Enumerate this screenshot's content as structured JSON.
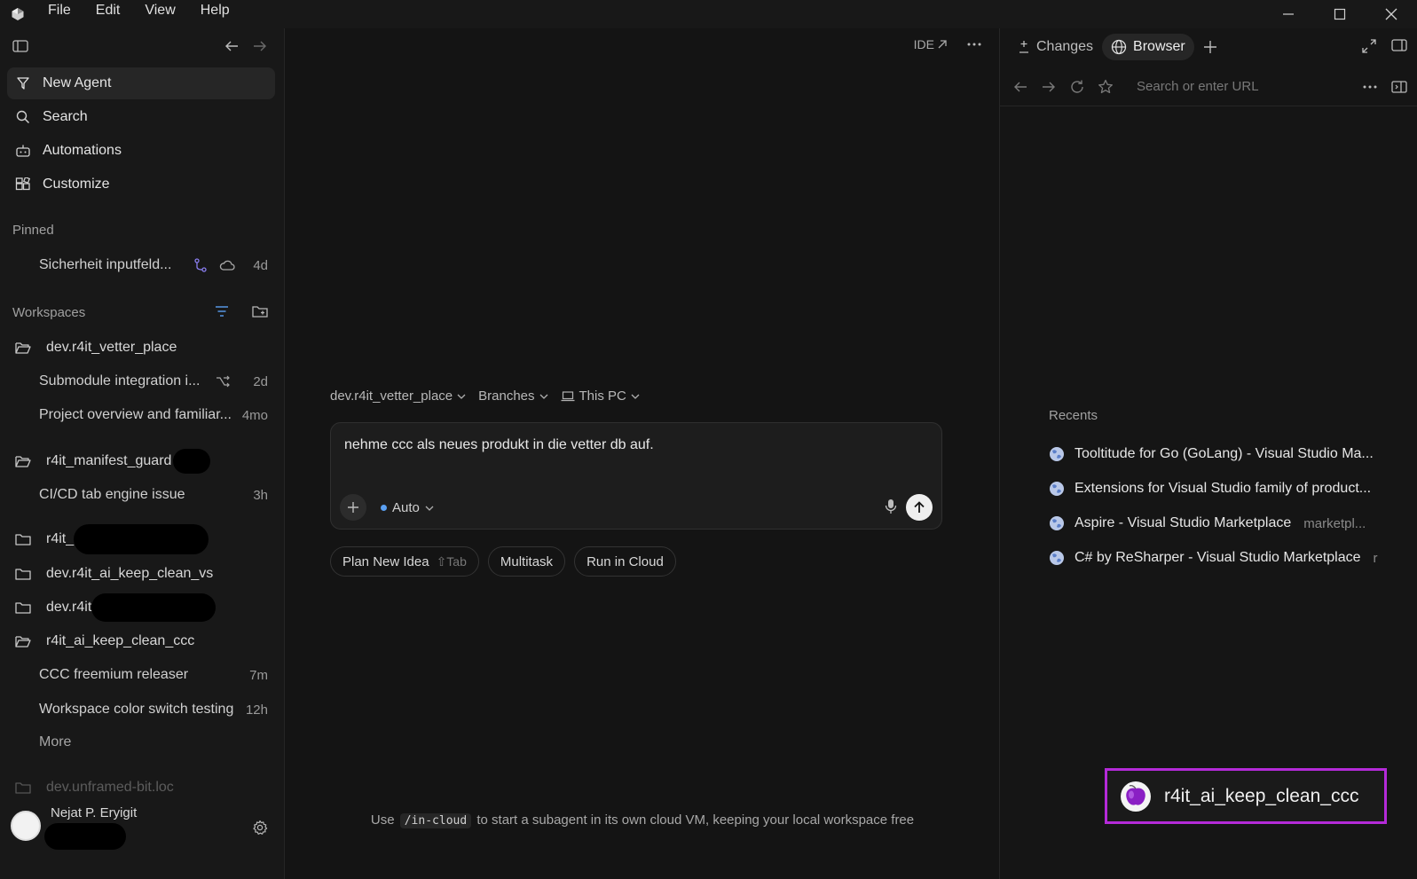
{
  "menu": [
    "File",
    "Edit",
    "View",
    "Help"
  ],
  "sidebar": {
    "nav": [
      {
        "label": "New Agent",
        "icon": "agent-icon"
      },
      {
        "label": "Search",
        "icon": "search-icon"
      },
      {
        "label": "Automations",
        "icon": "robot-icon"
      },
      {
        "label": "Customize",
        "icon": "customize-icon"
      }
    ],
    "pinned_label": "Pinned",
    "pinned": [
      {
        "title": "Sicherheit inputfeld...",
        "age": "4d"
      }
    ],
    "workspaces_label": "Workspaces",
    "workspaces": [
      {
        "name": "dev.r4it_vetter_place"
      },
      {
        "name": "r4it_manifest_guard"
      },
      {
        "name": "r4it_"
      },
      {
        "name": "dev.r4it_ai_keep_clean_vs"
      },
      {
        "name": "dev.r4it"
      },
      {
        "name": "r4it_ai_keep_clean_ccc"
      },
      {
        "name": "dev.unframed-bit.loc"
      }
    ],
    "threads": [
      {
        "title": "Submodule integration i...",
        "age": "2d"
      },
      {
        "title": "Project overview and familiar...",
        "age": "4mo"
      },
      {
        "title": "CI/CD tab engine issue",
        "age": "3h"
      },
      {
        "title": "CCC freemium releaser",
        "age": "7m"
      },
      {
        "title": "Workspace color switch testing",
        "age": "12h"
      }
    ],
    "more_label": "More",
    "user_name": "Nejat P. Eryigit"
  },
  "main": {
    "ide_label": "IDE",
    "context": {
      "workspace": "dev.r4it_vetter_place",
      "branches": "Branches",
      "location": "This PC"
    },
    "composer": {
      "text": "nehme ccc als neues produkt in die vetter db auf.",
      "mode": "Auto"
    },
    "chips": {
      "plan": "Plan New Idea",
      "plan_kbd": "⇧Tab",
      "multitask": "Multitask",
      "cloud": "Run in Cloud"
    },
    "hint": {
      "before": "Use",
      "code": "/in-cloud",
      "after": "to start a subagent in its own cloud VM, keeping your local workspace free"
    }
  },
  "right": {
    "tabs": {
      "changes": "Changes",
      "browser": "Browser"
    },
    "url_placeholder": "Search or enter URL",
    "recents_label": "Recents",
    "recents": [
      {
        "title": "Tooltitude for Go (GoLang) - Visual Studio Ma...",
        "domain": ""
      },
      {
        "title": "Extensions for Visual Studio family of product...",
        "domain": ""
      },
      {
        "title": "Aspire - Visual Studio Marketplace",
        "domain": "marketpl..."
      },
      {
        "title": "C# by ReSharper - Visual Studio Marketplace",
        "domain": "r"
      }
    ]
  },
  "badge": {
    "label": "r4it_ai_keep_clean_ccc"
  },
  "colors": {
    "accent_blue": "#5aa0f2",
    "badge_border": "#b42ad8",
    "branch_icon": "#8a7ef0"
  }
}
